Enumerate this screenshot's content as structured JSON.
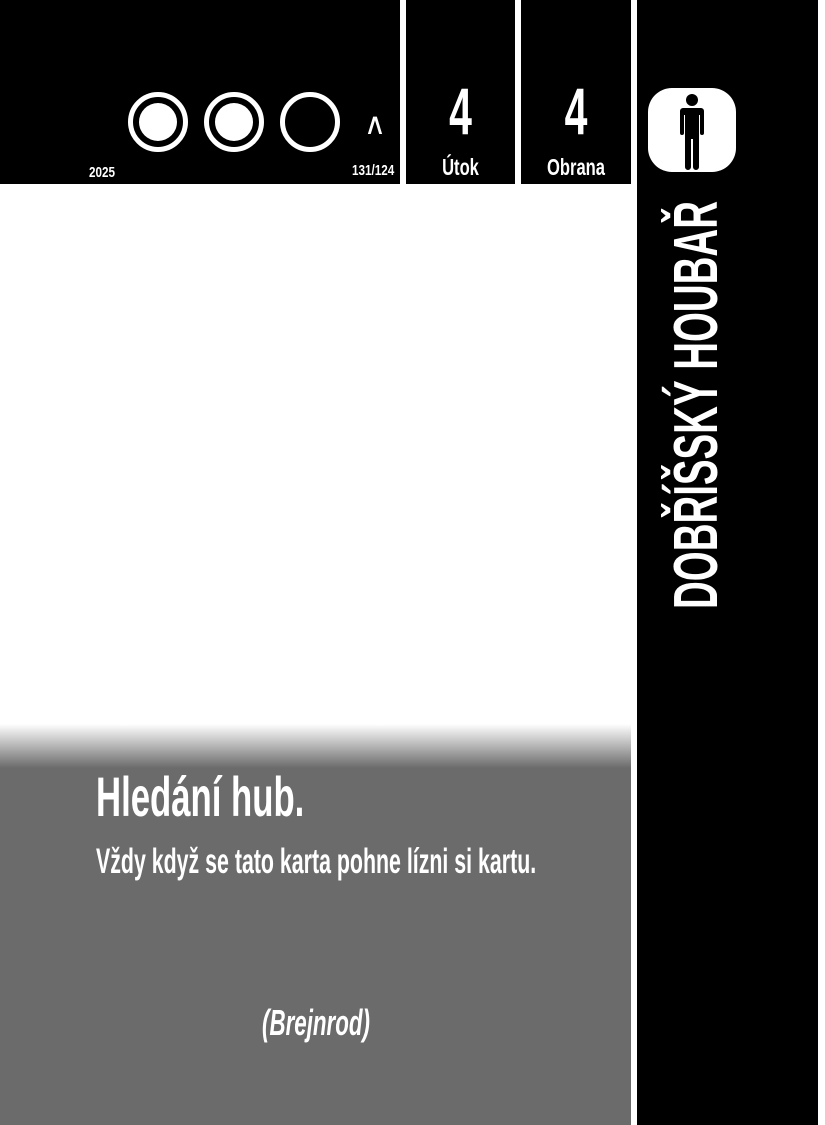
{
  "card": {
    "year": "2025",
    "set_number": "131/124",
    "attack": {
      "value": "4",
      "label": "Útok"
    },
    "defense": {
      "value": "4",
      "label": "Obrana"
    },
    "name": "DOBŘÍŠSKÝ HOUBAŘ",
    "type_icon": "person-icon",
    "cost": {
      "filled": 2,
      "total": 3
    },
    "level_icon": "caret-up-icon",
    "ability_title": "Hledání hub.",
    "ability_text": "Vždy když se tato karta pohne lízni si kartu.",
    "flavor": "(Brejnrod)"
  },
  "colors": {
    "header": "#000000",
    "text_panel": "#6b6b6b",
    "text": "#ffffff"
  }
}
